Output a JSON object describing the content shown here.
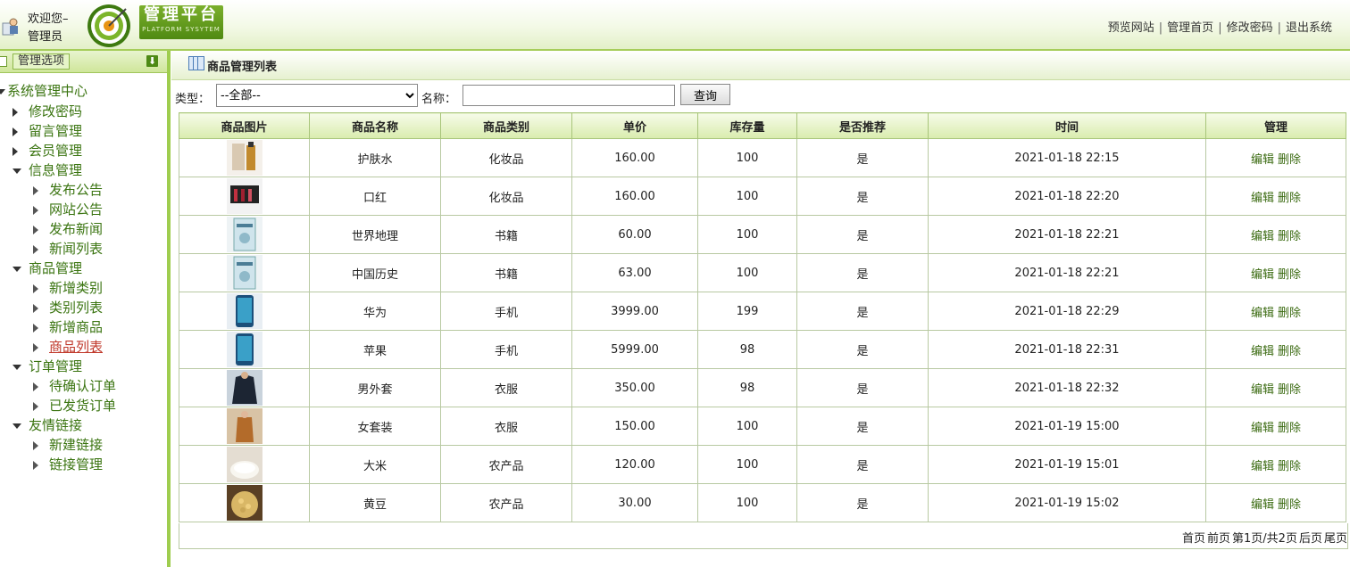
{
  "header": {
    "welcome_line1": "欢迎您–",
    "welcome_line2": "管理员",
    "logo_title": "管理平台",
    "logo_subtitle": "PLATFORM SYSYTEM",
    "nav": [
      "预览网站",
      "管理首页",
      "修改密码",
      "退出系统"
    ]
  },
  "sidebar": {
    "title": "管理选项",
    "root": "系统管理中心",
    "items": [
      {
        "label": "修改密码",
        "level": 1,
        "state": "closed"
      },
      {
        "label": "留言管理",
        "level": 1,
        "state": "closed"
      },
      {
        "label": "会员管理",
        "level": 1,
        "state": "closed"
      },
      {
        "label": "信息管理",
        "level": 1,
        "state": "open"
      },
      {
        "label": "发布公告",
        "level": 2,
        "state": "leaf"
      },
      {
        "label": "网站公告",
        "level": 2,
        "state": "leaf"
      },
      {
        "label": "发布新闻",
        "level": 2,
        "state": "leaf"
      },
      {
        "label": "新闻列表",
        "level": 2,
        "state": "leaf"
      },
      {
        "label": "商品管理",
        "level": 1,
        "state": "open"
      },
      {
        "label": "新增类别",
        "level": 2,
        "state": "leaf"
      },
      {
        "label": "类别列表",
        "level": 2,
        "state": "leaf"
      },
      {
        "label": "新增商品",
        "level": 2,
        "state": "leaf"
      },
      {
        "label": "商品列表",
        "level": 2,
        "state": "leaf",
        "active": true
      },
      {
        "label": "订单管理",
        "level": 1,
        "state": "open"
      },
      {
        "label": "待确认订单",
        "level": 2,
        "state": "leaf"
      },
      {
        "label": "已发货订单",
        "level": 2,
        "state": "leaf"
      },
      {
        "label": "友情链接",
        "level": 1,
        "state": "open"
      },
      {
        "label": "新建链接",
        "level": 2,
        "state": "leaf"
      },
      {
        "label": "链接管理",
        "level": 2,
        "state": "leaf"
      }
    ]
  },
  "main": {
    "title": "商品管理列表",
    "filter": {
      "type_label": "类型：",
      "type_value": "--全部--",
      "name_label": "名称：",
      "name_value": "",
      "search_button": "查询"
    },
    "columns": [
      "商品图片",
      "商品名称",
      "商品类别",
      "单价",
      "库存量",
      "是否推荐",
      "时间",
      "管理"
    ],
    "rows": [
      {
        "name": "护肤水",
        "category": "化妆品",
        "price": "160.00",
        "stock": "100",
        "recommend": "是",
        "time": "2021-01-18 22:15",
        "img": "skincare-image"
      },
      {
        "name": "口红",
        "category": "化妆品",
        "price": "160.00",
        "stock": "100",
        "recommend": "是",
        "time": "2021-01-18 22:20",
        "img": "lipstick-image"
      },
      {
        "name": "世界地理",
        "category": "书籍",
        "price": "60.00",
        "stock": "100",
        "recommend": "是",
        "time": "2021-01-18 22:21",
        "img": "book-image"
      },
      {
        "name": "中国历史",
        "category": "书籍",
        "price": "63.00",
        "stock": "100",
        "recommend": "是",
        "time": "2021-01-18 22:21",
        "img": "book-image"
      },
      {
        "name": "华为",
        "category": "手机",
        "price": "3999.00",
        "stock": "199",
        "recommend": "是",
        "time": "2021-01-18 22:29",
        "img": "phone-image"
      },
      {
        "name": "苹果",
        "category": "手机",
        "price": "5999.00",
        "stock": "98",
        "recommend": "是",
        "time": "2021-01-18 22:31",
        "img": "phone-image"
      },
      {
        "name": "男外套",
        "category": "衣服",
        "price": "350.00",
        "stock": "98",
        "recommend": "是",
        "time": "2021-01-18 22:32",
        "img": "jacket-image"
      },
      {
        "name": "女套装",
        "category": "衣服",
        "price": "150.00",
        "stock": "100",
        "recommend": "是",
        "time": "2021-01-19 15:00",
        "img": "outfit-image"
      },
      {
        "name": "大米",
        "category": "农产品",
        "price": "120.00",
        "stock": "100",
        "recommend": "是",
        "time": "2021-01-19 15:01",
        "img": "rice-image"
      },
      {
        "name": "黄豆",
        "category": "农产品",
        "price": "30.00",
        "stock": "100",
        "recommend": "是",
        "time": "2021-01-19 15:02",
        "img": "soybean-image"
      }
    ],
    "ops": {
      "edit": "编辑",
      "delete": "删除"
    },
    "pager": [
      "首页",
      "前页",
      "第1页/共2页",
      "后页",
      "尾页"
    ]
  },
  "colors": {
    "brand_green": "#4f8a12",
    "sidebar_link": "#3a7410",
    "active_link": "#c0392b",
    "border_green": "#9fcd4f"
  }
}
